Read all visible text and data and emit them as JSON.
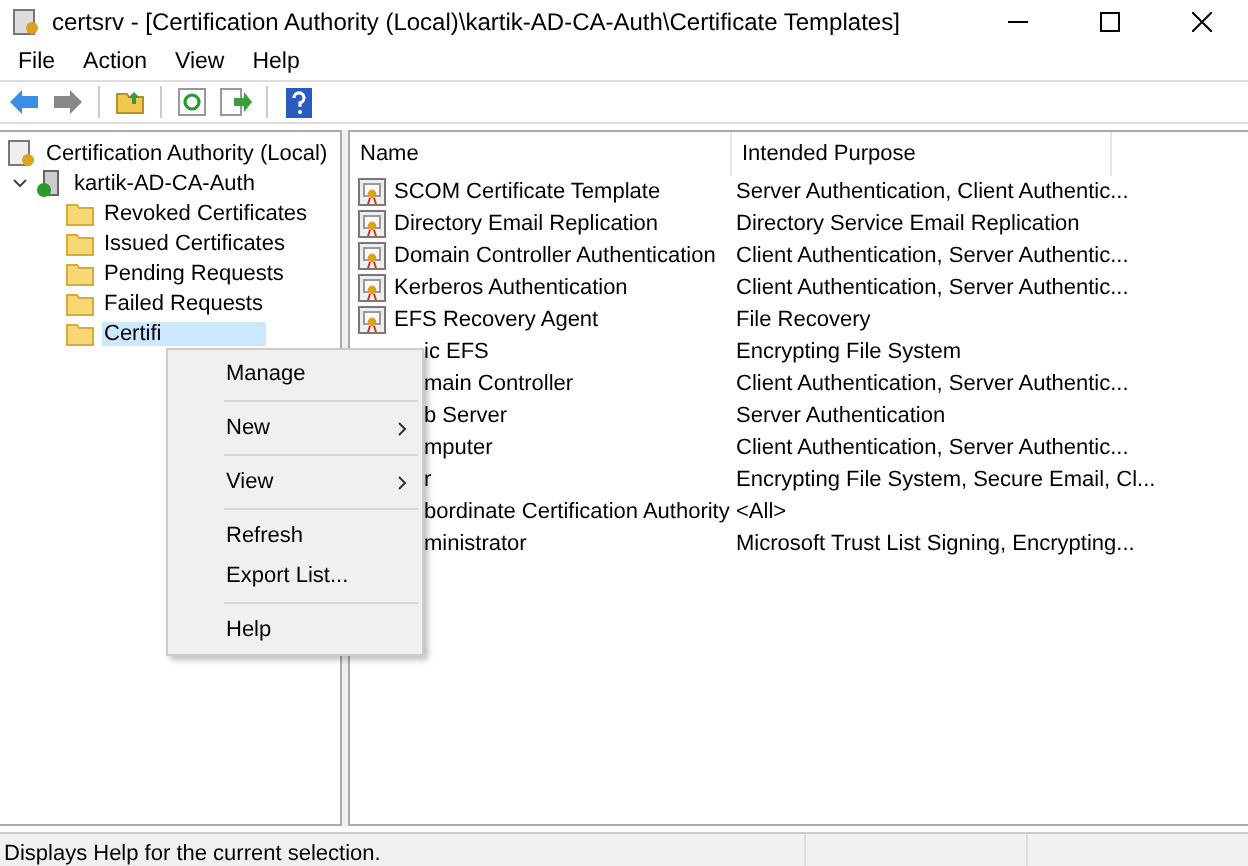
{
  "window": {
    "title": "certsrv - [Certification Authority (Local)\\kartik-AD-CA-Auth\\Certificate Templates]"
  },
  "menu_bar": [
    "File",
    "Action",
    "View",
    "Help"
  ],
  "tree": {
    "label": "Certification Authority (Local)",
    "children": [
      {
        "label": "kartik-AD-CA-Auth",
        "expanded": true,
        "children": [
          {
            "label": "Revoked Certificates",
            "selected": false
          },
          {
            "label": "Issued Certificates",
            "selected": false
          },
          {
            "label": "Pending Requests",
            "selected": false
          },
          {
            "label": "Failed Requests",
            "selected": false
          },
          {
            "label": "Certifi",
            "selected": true
          }
        ]
      }
    ]
  },
  "table": {
    "columns": [
      "Name",
      "Intended Purpose"
    ],
    "rows": [
      {
        "name": "SCOM Certificate Template",
        "purpose": "Server Authentication, Client Authentic...",
        "icon_visible": true
      },
      {
        "name": "Directory Email Replication",
        "purpose": "Directory Service Email Replication",
        "icon_visible": true
      },
      {
        "name": "Domain Controller Authentication",
        "purpose": "Client Authentication, Server Authentic...",
        "icon_visible": true
      },
      {
        "name": "Kerberos Authentication",
        "purpose": "Client Authentication, Server Authentic...",
        "icon_visible": true
      },
      {
        "name": "EFS Recovery Agent",
        "purpose": "File Recovery",
        "icon_visible": true
      },
      {
        "name": "ic EFS",
        "purpose": "Encrypting File System",
        "icon_visible": false
      },
      {
        "name": "main Controller",
        "purpose": "Client Authentication, Server Authentic...",
        "icon_visible": false
      },
      {
        "name": "b Server",
        "purpose": "Server Authentication",
        "icon_visible": false
      },
      {
        "name": "mputer",
        "purpose": "Client Authentication, Server Authentic...",
        "icon_visible": false
      },
      {
        "name": "r",
        "purpose": "Encrypting File System, Secure Email, Cl...",
        "icon_visible": false
      },
      {
        "name": "bordinate Certification Authority",
        "purpose": "<All>",
        "icon_visible": false
      },
      {
        "name": "ministrator",
        "purpose": "Microsoft Trust List Signing, Encrypting...",
        "icon_visible": false
      }
    ]
  },
  "context_menu": [
    {
      "kind": "item",
      "label": "Manage"
    },
    {
      "kind": "separator"
    },
    {
      "kind": "submenu",
      "label": "New"
    },
    {
      "kind": "separator"
    },
    {
      "kind": "submenu",
      "label": "View"
    },
    {
      "kind": "separator"
    },
    {
      "kind": "item",
      "label": "Refresh"
    },
    {
      "kind": "item",
      "label": "Export List..."
    },
    {
      "kind": "separator"
    },
    {
      "kind": "item",
      "label": "Help"
    }
  ],
  "status_bar": "Displays Help for the current selection."
}
